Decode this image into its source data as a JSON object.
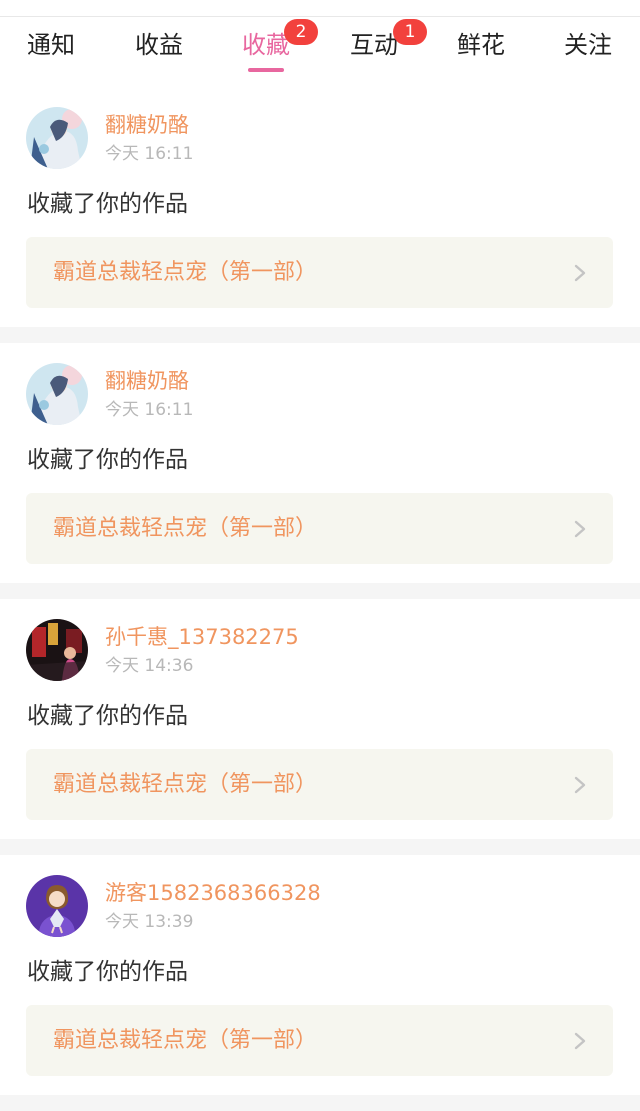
{
  "tabs": [
    {
      "label": "通知",
      "badge": null,
      "active": false
    },
    {
      "label": "收益",
      "badge": null,
      "active": false
    },
    {
      "label": "收藏",
      "badge": "2",
      "active": true
    },
    {
      "label": "互动",
      "badge": "1",
      "active": false
    },
    {
      "label": "鲜花",
      "badge": null,
      "active": false
    },
    {
      "label": "关注",
      "badge": null,
      "active": false
    }
  ],
  "notifications": [
    {
      "username": "翻糖奶酪",
      "time": "今天 16:11",
      "message": "收藏了你的作品",
      "work_title": "霸道总裁轻点宠（第一部）",
      "avatar": "anime-girl-avatar"
    },
    {
      "username": "翻糖奶酪",
      "time": "今天 16:11",
      "message": "收藏了你的作品",
      "work_title": "霸道总裁轻点宠（第一部）",
      "avatar": "anime-girl-avatar"
    },
    {
      "username": "孙千惠_137382275",
      "time": "今天 14:36",
      "message": "收藏了你的作品",
      "work_title": "霸道总裁轻点宠（第一部）",
      "avatar": "photo-avatar"
    },
    {
      "username": "游客1582368366328",
      "time": "今天 13:39",
      "message": "收藏了你的作品",
      "work_title": "霸道总裁轻点宠（第一部）",
      "avatar": "cartoon-girl-avatar"
    }
  ],
  "colors": {
    "accent": "#e8679f",
    "badge": "#f2413d",
    "username": "#f0955f",
    "card_box": "#f6f6ef"
  }
}
